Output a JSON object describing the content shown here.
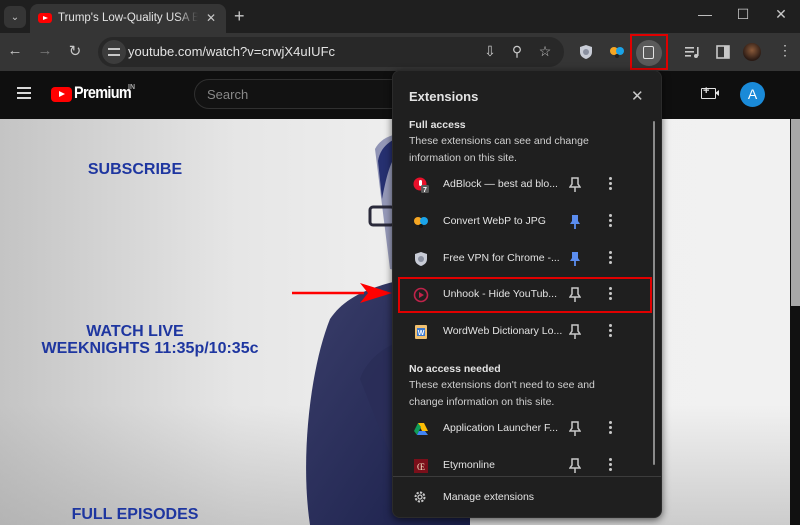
{
  "browser": {
    "tab": {
      "title": "Trump's Low-Quality USA Bibles",
      "close_glyph": "✕"
    },
    "tab_list_glyph": "⌄",
    "new_tab_glyph": "+",
    "window_controls": {
      "minimize": "—",
      "maximize": "☐",
      "close": "✕"
    },
    "nav": {
      "back": "←",
      "forward": "→",
      "reload": "↻"
    },
    "url": "youtube.com/watch?v=crwjX4uIUFc",
    "omnibox_icons": {
      "install": "⇩",
      "zoom": "⚲",
      "bookmark": "☆"
    },
    "menu_glyph": "⋮"
  },
  "youtube": {
    "brand": "Premium",
    "region": "IN",
    "search_placeholder": "Search",
    "avatar_letter": "A"
  },
  "video": {
    "promo_subscribe": "SUBSCRIBE",
    "promo_watch_live": "WATCH LIVE",
    "promo_schedule": "WEEKNIGHTS 11:35p/10:35c",
    "promo_full_episodes": "FULL EPISODES"
  },
  "extensions_popup": {
    "title": "Extensions",
    "close_glyph": "✕",
    "full_access": {
      "heading": "Full access",
      "description": "These extensions can see and change information on this site.",
      "items": [
        {
          "name": "AdBlock — best ad blo...",
          "icon": "adblock-icon",
          "badge": "7",
          "pinned": false
        },
        {
          "name": "Convert WebP to JPG",
          "icon": "convert-webp-icon",
          "pinned": true
        },
        {
          "name": "Free VPN for Chrome -...",
          "icon": "vpn-shield-icon",
          "pinned": true
        },
        {
          "name": "Unhook - Hide YouTub...",
          "icon": "unhook-icon",
          "pinned": false,
          "highlighted": true
        },
        {
          "name": "WordWeb Dictionary Lo...",
          "icon": "wordweb-icon",
          "pinned": false
        }
      ]
    },
    "no_access": {
      "heading": "No access needed",
      "description": "These extensions don't need to see and change information on this site.",
      "items": [
        {
          "name": "Application Launcher F...",
          "icon": "google-drive-icon",
          "pinned": false
        },
        {
          "name": "Etymonline",
          "icon": "etymonline-icon",
          "pinned": false
        }
      ]
    },
    "manage_label": "Manage extensions"
  },
  "colors": {
    "pin_active": "#5b8def",
    "highlight": "#e00000",
    "promo_text": "#1e36a0"
  }
}
